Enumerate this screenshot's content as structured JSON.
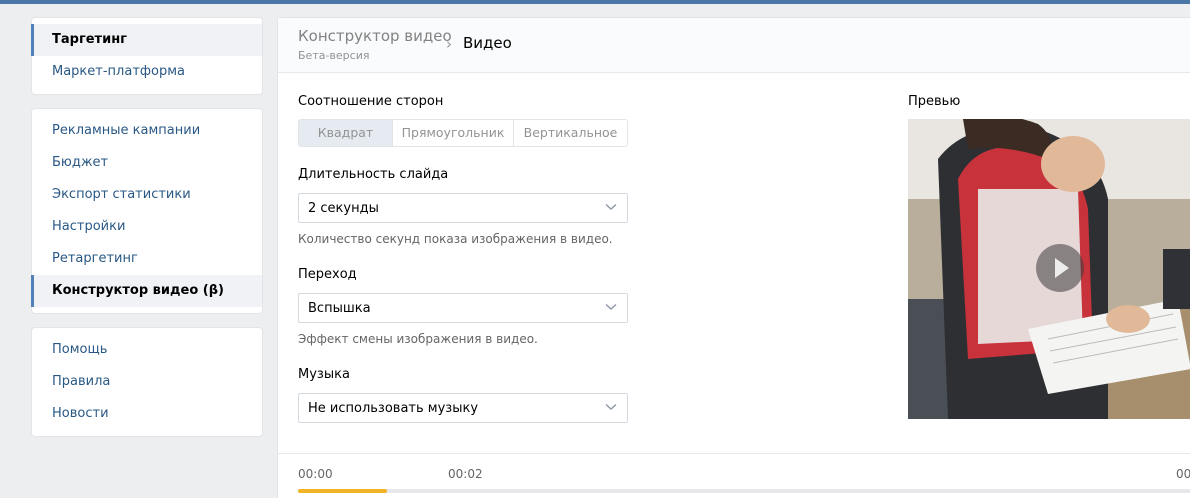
{
  "sidebar": {
    "group1": [
      "Таргетинг",
      "Маркет-платформа"
    ],
    "group2": [
      "Рекламные кампании",
      "Бюджет",
      "Экспорт статистики",
      "Настройки",
      "Ретаргетинг",
      "Конструктор видео (β)"
    ],
    "group3": [
      "Помощь",
      "Правила",
      "Новости"
    ],
    "active_group1": "Таргетинг",
    "active_group2": "Конструктор видео (β)"
  },
  "header": {
    "parent": "Конструктор видео",
    "parent_sub": "Бета-версия",
    "separator": "›",
    "current": "Видео"
  },
  "form": {
    "aspect_label": "Соотношение сторон",
    "aspect_options": [
      "Квадрат",
      "Прямоугольник",
      "Вертикальное"
    ],
    "aspect_selected": "Квадрат",
    "duration_label": "Длительность слайда",
    "duration_value": "2 секунды",
    "duration_hint": "Количество секунд показа изображения в видео.",
    "transition_label": "Переход",
    "transition_value": "Вспышка",
    "transition_hint": "Эффект смены изображения в видео.",
    "music_label": "Музыка",
    "music_value": "Не использовать музыку"
  },
  "preview": {
    "label": "Превью"
  },
  "timeline": {
    "t0": "00:00",
    "t1": "00:02",
    "t2": "00",
    "progress_fraction": 0.1
  },
  "colors": {
    "accent": "#5181b8",
    "link": "#2a5885",
    "progress": "#f0b323",
    "topbar": "#4a76a8"
  }
}
